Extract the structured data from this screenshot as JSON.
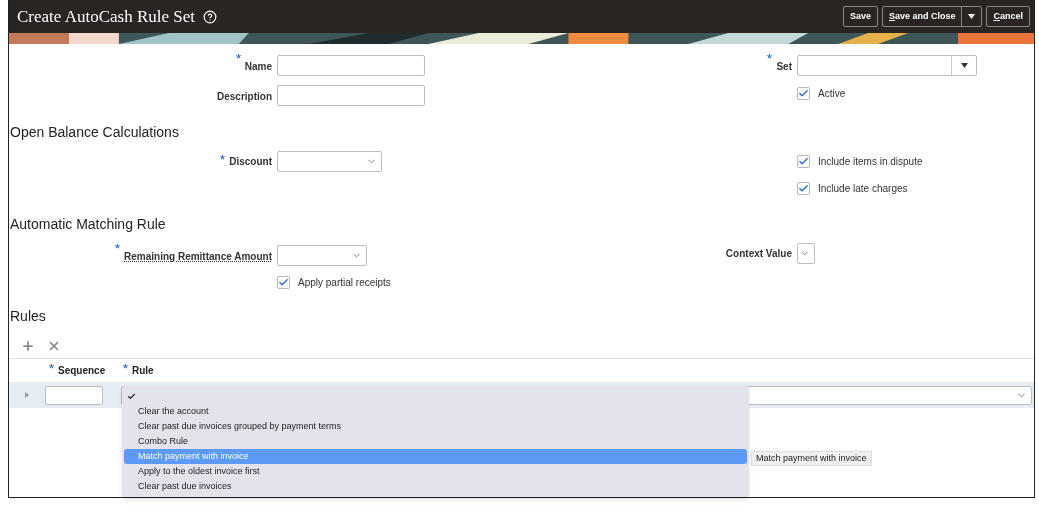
{
  "header": {
    "title": "Create AutoCash Rule Set",
    "buttons": [
      {
        "label": "Save",
        "kind": "button",
        "mnemonic": false
      },
      {
        "label": "Save and Close",
        "kind": "split",
        "mnemonic": true
      },
      {
        "label": "Cancel",
        "kind": "button",
        "mnemonic": true
      }
    ]
  },
  "general": {
    "name": {
      "label": "Name",
      "required": true
    },
    "description": {
      "label": "Description",
      "required": false
    },
    "set": {
      "label": "Set",
      "required": true
    },
    "active": {
      "label": "Active",
      "checked": true
    }
  },
  "open_balance": {
    "heading": "Open Balance Calculations",
    "discount": {
      "label": "Discount",
      "required": true
    },
    "options": [
      {
        "label": "Include items in dispute",
        "checked": true
      },
      {
        "label": "Include late charges",
        "checked": true
      }
    ]
  },
  "matching": {
    "heading": "Automatic Matching Rule",
    "remaining": {
      "label": "Remaining Remittance Amount",
      "required": true
    },
    "context": {
      "label": "Context Value",
      "required": false
    },
    "partial": {
      "label": "Apply partial receipts",
      "checked": true
    }
  },
  "rules": {
    "heading": "Rules",
    "columns": [
      {
        "label": "Sequence",
        "required": true
      },
      {
        "label": "Rule",
        "required": true
      }
    ],
    "menu": [
      {
        "checked": true,
        "selected": false
      },
      {
        "label": "Clear the account",
        "checked": false,
        "selected": false
      },
      {
        "label": "Clear past due invoices grouped by payment terms",
        "checked": false,
        "selected": false
      },
      {
        "label": "Combo Rule",
        "checked": false,
        "selected": false
      },
      {
        "label": "Match payment with invoice",
        "checked": false,
        "selected": true
      },
      {
        "label": "Apply to the oldest invoice first",
        "checked": false,
        "selected": false
      },
      {
        "label": "Clear past due invoices",
        "checked": false,
        "selected": false
      }
    ],
    "tooltip": "Match payment with invoice"
  }
}
